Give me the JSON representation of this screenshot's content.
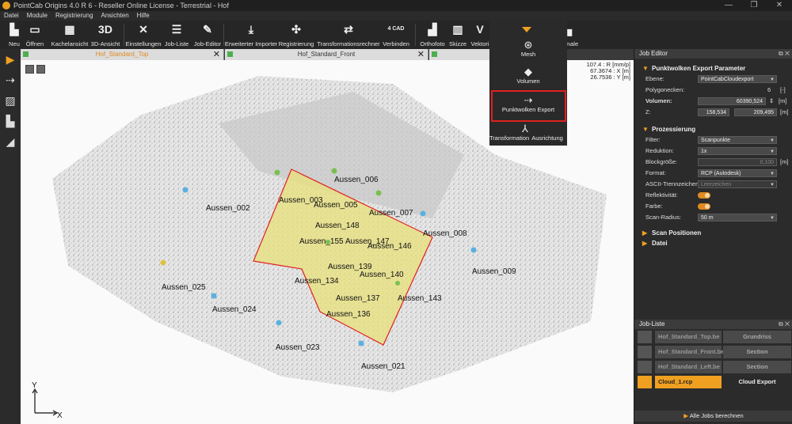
{
  "window": {
    "title": "PointCab Origins 4.0 R 6 - Reseller Online License - Terrestrial - Hof",
    "controls": [
      "—",
      "❐",
      "✕"
    ]
  },
  "menu": [
    "Datei",
    "Module",
    "Registrierung",
    "Ansichten",
    "Hilfe"
  ],
  "toolbar": [
    {
      "label": "Neu",
      "icon": "new-icon"
    },
    {
      "label": "Öffnen",
      "icon": "folder-icon"
    },
    {
      "label": "Kachelansicht",
      "icon": "tiles-icon"
    },
    {
      "label": "3D-Ansicht",
      "icon": "3d-icon",
      "glyph": "3D"
    },
    {
      "label": "Einstellungen",
      "icon": "settings-icon"
    },
    {
      "label": "Job-Liste",
      "icon": "job-list-icon"
    },
    {
      "label": "Job-Editor",
      "icon": "job-editor-icon"
    },
    {
      "label": "Erweiterter Importer",
      "icon": "import-icon"
    },
    {
      "label": "Registrierung",
      "icon": "registration-icon"
    },
    {
      "label": "Transformationsrechner",
      "icon": "transform-calc-icon"
    },
    {
      "label": "Verbinden",
      "icon": "4cad-icon",
      "glyph": "4 CAD"
    },
    {
      "label": "Orthofoto",
      "icon": "orthophoto-icon"
    },
    {
      "label": "Skizze",
      "icon": "sketch-icon"
    },
    {
      "label": "Vektori",
      "icon": "vector-icon"
    },
    {
      "label": "male",
      "icon": "partial-icon"
    }
  ],
  "tabs": [
    {
      "title": "Hof_Standard_Top",
      "active": true
    },
    {
      "title": "Hof_Standard_Front",
      "active": false
    },
    {
      "title": "",
      "active": false
    }
  ],
  "viewport": {
    "readout": [
      "107.4 : R [mm/p]",
      "67.3674 : X [m]",
      "26.7536 : Y [m]"
    ],
    "axis_y": "Y",
    "axis_x": "X",
    "markers": [
      "Aussen_002",
      "Aussen_003",
      "Aussen_006",
      "Aussen_005",
      "Aussen_007",
      "Aussen_008",
      "Aussen_009",
      "Aussen_148",
      "Aussen_147",
      "Aussen_146",
      "Aussen_155",
      "Aussen_139",
      "Aussen_140",
      "Aussen_134",
      "Aussen_137",
      "Aussen_143",
      "Aussen_136",
      "Aussen_025",
      "Aussen_024",
      "Aussen_023",
      "Aussen_021"
    ]
  },
  "dropdown": {
    "items": [
      {
        "label": "Mesh",
        "icon": "mesh-icon"
      },
      {
        "label": "Volumen",
        "icon": "volume-icon"
      },
      {
        "label": "Punktwolken Export",
        "icon": "pointcloud-export-icon",
        "highlighted": true
      },
      {
        "label": "Transformation",
        "icon": "transformation-icon"
      },
      {
        "label": "Ausrichtung",
        "icon": "alignment-icon"
      }
    ]
  },
  "job_editor": {
    "title": "Job Editor",
    "section1": "Punktwolken Export Parameter",
    "ebene_label": "Ebene:",
    "ebene_value": "PointCabCloudexport",
    "polygon_label": "Polygonecken:",
    "polygon_value": "6",
    "polygon_unit": "[-]",
    "volumen_label": "Volumen:",
    "volumen_value": "60390,524",
    "volumen_unit": "[m]",
    "z_label": "Z:",
    "z_min": "158,534",
    "z_max": "209,495",
    "z_unit": "[m]",
    "section2": "Prozessierung",
    "filter_label": "Filter:",
    "filter_value": "Scanpunkte",
    "reduktion_label": "Reduktion:",
    "reduktion_value": "1x",
    "block_label": "Blockgröße:",
    "block_value": "0,100",
    "block_unit": "[m]",
    "format_label": "Format:",
    "format_value": "RCP (Autodesk)",
    "ascii_label": "ASCII-Trennzeichen:",
    "ascii_value": "Leerzeichen",
    "reflekt_label": "Reflektivität:",
    "farbe_label": "Farbe:",
    "scanradius_label": "Scan-Radius:",
    "scanradius_value": "50 m",
    "section3": "Scan Positionen",
    "section4": "Datei"
  },
  "job_list": {
    "title": "Job-Liste",
    "jobs": [
      {
        "name": "Hof_Standard_Top.be",
        "type": "Grundriss",
        "selected": false
      },
      {
        "name": "Hof_Standard_Front.be",
        "type": "Section",
        "selected": false
      },
      {
        "name": "Hof_Standard_Left.be",
        "type": "Section",
        "selected": false
      },
      {
        "name": "Cloud_1.rcp",
        "type": "Cloud Export",
        "selected": true
      }
    ],
    "run_all": "Alle Jobs berechnen"
  },
  "colors": {
    "accent": "#f0a020",
    "highlight": "#e02020",
    "polygon_fill": "#e8e07a"
  }
}
